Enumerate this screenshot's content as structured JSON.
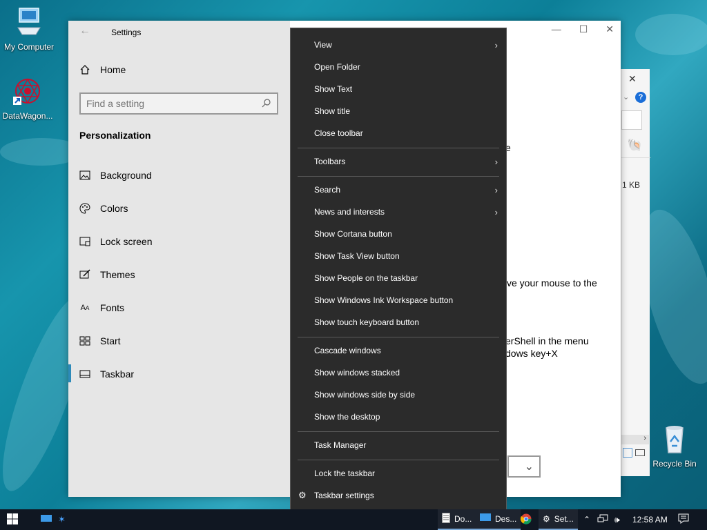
{
  "desktop": {
    "icons": [
      {
        "label": "My Computer",
        "icon": "computer-icon"
      },
      {
        "label": "DataWagon...",
        "icon": "datawagon-shortcut-icon"
      },
      {
        "label": "Recycle Bin",
        "icon": "recycle-bin-icon"
      }
    ]
  },
  "settings": {
    "title": "Settings",
    "home_label": "Home",
    "search_placeholder": "Find a setting",
    "section_title": "Personalization",
    "nav_items": [
      {
        "label": "Background",
        "icon": "background-icon"
      },
      {
        "label": "Colors",
        "icon": "colors-icon"
      },
      {
        "label": "Lock screen",
        "icon": "lock-screen-icon"
      },
      {
        "label": "Themes",
        "icon": "themes-icon"
      },
      {
        "label": "Fonts",
        "icon": "fonts-icon"
      },
      {
        "label": "Start",
        "icon": "start-icon"
      },
      {
        "label": "Taskbar",
        "icon": "taskbar-icon"
      }
    ],
    "active_item": "Taskbar",
    "content_fragments": {
      "frag1": "e",
      "frag2": "ve your mouse to the",
      "frag3": "erShell in the menu",
      "frag4": "dows key+X"
    },
    "accent_color": "#2d8ab9"
  },
  "explorer": {
    "size_text": "1 KB"
  },
  "context_menu": {
    "items": [
      {
        "label": "View",
        "submenu": true
      },
      {
        "label": "Open Folder",
        "submenu": false
      },
      {
        "label": "Show Text",
        "submenu": false
      },
      {
        "label": "Show title",
        "submenu": false
      },
      {
        "label": "Close toolbar",
        "submenu": false
      },
      {
        "label": "Toolbars",
        "submenu": true
      },
      {
        "label": "Search",
        "submenu": true
      },
      {
        "label": "News and interests",
        "submenu": true
      },
      {
        "label": "Show Cortana button",
        "submenu": false
      },
      {
        "label": "Show Task View button",
        "submenu": false
      },
      {
        "label": "Show People on the taskbar",
        "submenu": false
      },
      {
        "label": "Show Windows Ink Workspace button",
        "submenu": false
      },
      {
        "label": "Show touch keyboard button",
        "submenu": false
      },
      {
        "label": "Cascade windows",
        "submenu": false
      },
      {
        "label": "Show windows stacked",
        "submenu": false
      },
      {
        "label": "Show windows side by side",
        "submenu": false
      },
      {
        "label": "Show the desktop",
        "submenu": false
      },
      {
        "label": "Task Manager",
        "submenu": false
      },
      {
        "label": "Lock the taskbar",
        "submenu": false
      },
      {
        "label": "Taskbar settings",
        "submenu": false,
        "icon": "gear-icon"
      }
    ]
  },
  "taskbar": {
    "tasks": [
      {
        "label": "Do...",
        "icon": "document-icon"
      },
      {
        "label": "Des...",
        "icon": "desktop-icon"
      },
      {
        "label": "",
        "icon": "chrome-icon"
      },
      {
        "label": "Set...",
        "icon": "gear-icon"
      }
    ],
    "clock": "12:58 AM"
  }
}
